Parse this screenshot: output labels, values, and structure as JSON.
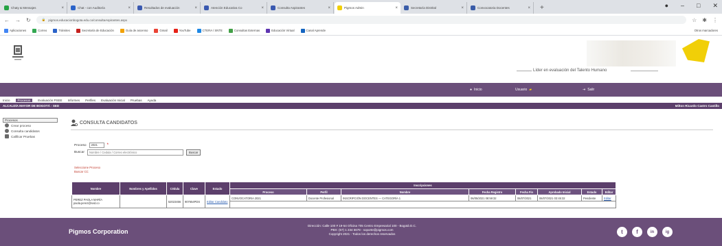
{
  "browser": {
    "tabs": [
      {
        "title": "Chaty & Mensajes",
        "color": "#25a244"
      },
      {
        "title": "Chat - con Auditoría",
        "color": "#2b63c9"
      },
      {
        "title": "Resultados de evaluación",
        "color": "#3a59b0"
      },
      {
        "title": "Atención Educativa Co",
        "color": "#3a59b0"
      },
      {
        "title": "Consulta Aspirantes",
        "color": "#3a59b0"
      },
      {
        "title": "Pigmos Admin",
        "color": "#f1cf08",
        "active": true
      },
      {
        "title": "Secretaría Distrital",
        "color": "#3a5ca8"
      },
      {
        "title": "Convocatoria Docentes",
        "color": "#3a5ca8"
      }
    ],
    "new_tab": "+",
    "window_controls": [
      "●",
      "–",
      "□",
      "✕"
    ],
    "url": "pigmos.educacionbogota.edu.co/consultaAspirantes.aspx",
    "bookmarks": [
      "Aplicaciones",
      "Correo",
      "Trámites",
      "Secretaría de Educación",
      "Guía de ascenso",
      "Gmail",
      "YouTube",
      "CTERA / SNTE",
      "Consultas Externas",
      "Educación Virtual",
      "Canal Aprende"
    ],
    "bookmarks_other": "Otros marcadores"
  },
  "site": {
    "slogan": "Líder en evaluación del Talento Humano",
    "top_items": [
      "Inicio",
      "Usuario",
      "Salir"
    ],
    "menu": [
      "Inicio",
      "Procesos",
      "Evaluación PSEE",
      "Informes",
      "Perfiles",
      "Evaluación Inicial",
      "Pruebas",
      "Ayuda"
    ],
    "menu_selected": 1,
    "darkbar_left": "ALCALDÍA MAYOR DE BOGOTÁ - SED",
    "darkbar_right": "Milton Ricardo Castro Castillo"
  },
  "sidebar": {
    "header": "Procesos",
    "items": [
      "Crear proceso",
      "Consulta candidatos",
      "Calificar Pruebas"
    ]
  },
  "main": {
    "title": "CONSULTA CANDIDATOS",
    "proceso_label": "Proceso",
    "proceso_value": "2021",
    "buscar_label": "Buscar",
    "buscar_placeholder": "Nombre / Cedula / Correo electrónico",
    "buscar_button": "Buscar",
    "notes": [
      "Seleccione Proceso",
      "Buscar CC"
    ]
  },
  "table": {
    "headers": [
      "Nombre",
      "Nombres y Apellidos",
      "Cédula",
      "Clave",
      "Estado",
      "Inscripciones"
    ],
    "subheaders": [
      "Proceso",
      "Perfil",
      "Nombre",
      "Fecha Registro",
      "Fecha Fin",
      "Aprobado Inicial",
      "Estado",
      "Editar"
    ],
    "rows": [
      {
        "nombre": "PEREZ PAOLA MARÍA",
        "email": "paola.perez@sed.co",
        "nombres": "",
        "cedula": "52023456",
        "clave": "907654PDS",
        "estado": "Editar Candidato",
        "proceso": "CONVOCATORIA 2021",
        "perfil": "Docente Profesional",
        "nombre_proceso": "INSCRIPCIÓN DOCENTES — CATEGORÍA 1",
        "fecha_registro": "06/05/2021 08:59:32",
        "fecha_fin": "06/07/2021",
        "aprobado": "06/07/2021 03:45:32",
        "estado_ins": "Pendiente",
        "editar": "Editar"
      }
    ]
  },
  "footer": {
    "corp": "Pigmos Corporation",
    "address": [
      "Dirección: Calle 100 # 19-54 Oficina 705 Centro Empresarial 100 - Bogotá D.C.",
      "PBX: (57) 1 234 5678 - soporte@pigmos.com",
      "Copyright 2021 - Todos los derechos reservados"
    ],
    "social": [
      "t",
      "f",
      "in",
      "ig"
    ]
  }
}
